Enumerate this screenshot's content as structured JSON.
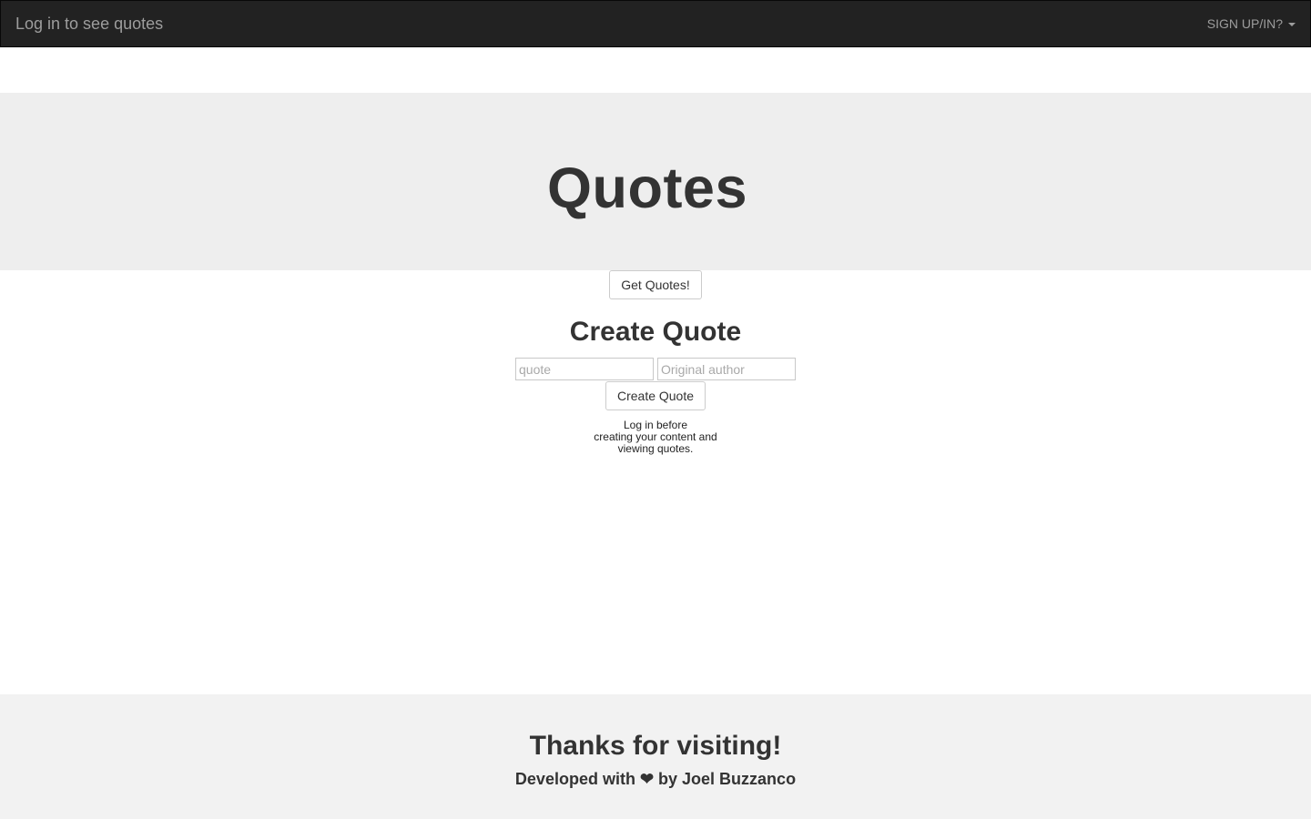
{
  "navbar": {
    "brand": "Log in to see quotes",
    "dropdown_label": "SIGN UP/IN?"
  },
  "jumbotron": {
    "title": "Quotes"
  },
  "main": {
    "get_quotes_label": "Get Quotes!",
    "create_title": "Create Quote",
    "quote_placeholder": "quote",
    "author_placeholder": "Original author",
    "create_button_label": "Create Quote",
    "notice_lines": [
      "Log in before",
      "creating your content and",
      "viewing quotes."
    ]
  },
  "footer": {
    "title": "Thanks for visiting!",
    "credit": "Developed with ❤ by Joel Buzzanco"
  },
  "colors": {
    "navbar_bg": "#222222",
    "navbar_text": "#9d9d9d",
    "jumbotron_bg": "#eeeeee",
    "footer_bg": "#f2f2f2",
    "text": "#333333"
  },
  "icons": {
    "dropdown": "caret-down-icon"
  }
}
